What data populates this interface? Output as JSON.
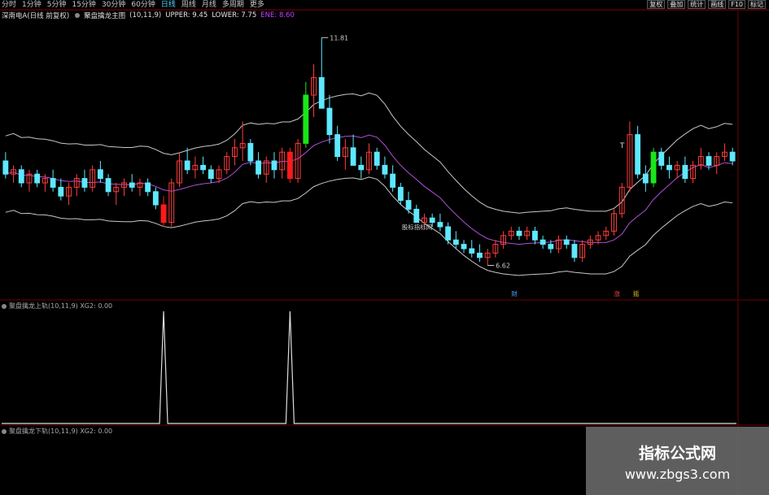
{
  "toolbar": {
    "periods": [
      "分时",
      "1分钟",
      "5分钟",
      "15分钟",
      "30分钟",
      "60分钟",
      "日线",
      "周线",
      "月线",
      "多周期",
      "更多"
    ],
    "active_period": "日线",
    "tools": [
      "复权",
      "叠加",
      "统计",
      "画线",
      "F10",
      "标记"
    ]
  },
  "main_panel": {
    "stock_name": "深南电A(日线 前复权)",
    "indicator_name": "聚盘擒龙主图",
    "params": "(10,11,9)",
    "upper_label": "UPPER: 9.45",
    "lower_label": "LOWER: 7.75",
    "ene_label": "ENE: 8.60",
    "high_annotation": "11.81",
    "low_annotation": "6.62",
    "overlay_text": "股标指标网",
    "t_marker": "T",
    "bottom_markers": [
      "财",
      "涨",
      "摇"
    ],
    "colors": {
      "up": "#ff3c3c",
      "down": "#5ee8ff",
      "signal_red": "#ff1a1a",
      "signal_green": "#19e619",
      "band": "#c8c8c8",
      "ene": "#b14fd6",
      "grid": "#6b0000"
    }
  },
  "sub_panel_1": {
    "label": "聚盘擒龙上轨(10,11,9) XG2: 0.00"
  },
  "sub_panel_2": {
    "label": "聚盘擒龙下轨(10,11,9) XG2: 0.00"
  },
  "watermark": {
    "title": "指标公式网",
    "url": "www.zbgs3.com"
  },
  "chart_data": {
    "type": "candlestick",
    "price_high": 11.81,
    "price_low": 6.62,
    "candles": [
      [
        9.0,
        9.2,
        8.6,
        8.7
      ],
      [
        8.7,
        8.9,
        8.5,
        8.8
      ],
      [
        8.8,
        8.9,
        8.4,
        8.5
      ],
      [
        8.5,
        8.8,
        8.3,
        8.7
      ],
      [
        8.7,
        8.8,
        8.4,
        8.5
      ],
      [
        8.5,
        8.7,
        8.3,
        8.6
      ],
      [
        8.6,
        8.8,
        8.3,
        8.4
      ],
      [
        8.4,
        8.6,
        8.1,
        8.2
      ],
      [
        8.2,
        8.5,
        8.0,
        8.4
      ],
      [
        8.4,
        8.7,
        8.2,
        8.6
      ],
      [
        8.6,
        8.8,
        8.3,
        8.4
      ],
      [
        8.4,
        8.9,
        8.3,
        8.8
      ],
      [
        8.8,
        9.0,
        8.5,
        8.6
      ],
      [
        8.6,
        8.7,
        8.2,
        8.3
      ],
      [
        8.3,
        8.5,
        8.0,
        8.4
      ],
      [
        8.4,
        8.6,
        8.2,
        8.5
      ],
      [
        8.5,
        8.7,
        8.3,
        8.4
      ],
      [
        8.4,
        8.6,
        8.2,
        8.5
      ],
      [
        8.5,
        8.6,
        8.2,
        8.3
      ],
      [
        8.3,
        8.4,
        7.9,
        8.0
      ],
      [
        8.0,
        8.2,
        7.5,
        7.6
      ],
      [
        7.6,
        8.6,
        7.5,
        8.5
      ],
      [
        8.5,
        9.2,
        8.4,
        9.0
      ],
      [
        9.0,
        9.3,
        8.7,
        8.8
      ],
      [
        8.8,
        9.1,
        8.6,
        8.9
      ],
      [
        8.9,
        9.1,
        8.7,
        8.8
      ],
      [
        8.8,
        8.9,
        8.5,
        8.6
      ],
      [
        8.6,
        8.9,
        8.5,
        8.8
      ],
      [
        8.8,
        9.2,
        8.7,
        9.1
      ],
      [
        9.1,
        9.5,
        8.9,
        9.3
      ],
      [
        9.3,
        9.9,
        9.0,
        9.4
      ],
      [
        9.4,
        9.5,
        8.9,
        9.0
      ],
      [
        9.0,
        9.2,
        8.6,
        8.7
      ],
      [
        8.7,
        9.1,
        8.5,
        9.0
      ],
      [
        9.0,
        9.2,
        8.6,
        8.8
      ],
      [
        8.8,
        9.3,
        8.6,
        9.2
      ],
      [
        9.2,
        9.3,
        8.5,
        8.6
      ],
      [
        8.6,
        9.5,
        8.5,
        9.4
      ],
      [
        9.4,
        10.8,
        9.3,
        10.5
      ],
      [
        10.5,
        11.2,
        10.0,
        10.9
      ],
      [
        10.9,
        11.81,
        10.6,
        10.2
      ],
      [
        10.2,
        10.5,
        9.4,
        9.6
      ],
      [
        9.6,
        9.8,
        9.0,
        9.1
      ],
      [
        9.1,
        9.5,
        8.8,
        9.3
      ],
      [
        9.3,
        9.6,
        8.9,
        8.9
      ],
      [
        8.9,
        9.1,
        8.6,
        8.8
      ],
      [
        8.8,
        9.4,
        8.7,
        9.2
      ],
      [
        9.2,
        9.3,
        8.8,
        8.9
      ],
      [
        8.9,
        9.1,
        8.6,
        8.7
      ],
      [
        8.7,
        8.9,
        8.3,
        8.4
      ],
      [
        8.4,
        8.5,
        8.0,
        8.1
      ],
      [
        8.1,
        8.3,
        7.8,
        7.9
      ],
      [
        7.9,
        8.0,
        7.6,
        7.6
      ],
      [
        7.6,
        7.8,
        7.5,
        7.7
      ],
      [
        7.7,
        7.8,
        7.5,
        7.6
      ],
      [
        7.6,
        7.8,
        7.4,
        7.5
      ],
      [
        7.5,
        7.6,
        7.1,
        7.2
      ],
      [
        7.2,
        7.4,
        7.0,
        7.1
      ],
      [
        7.1,
        7.2,
        6.9,
        7.0
      ],
      [
        7.0,
        7.2,
        6.8,
        6.9
      ],
      [
        6.9,
        7.1,
        6.7,
        6.8
      ],
      [
        6.8,
        7.0,
        6.62,
        6.9
      ],
      [
        6.9,
        7.2,
        6.8,
        7.1
      ],
      [
        7.1,
        7.4,
        7.0,
        7.3
      ],
      [
        7.3,
        7.5,
        7.2,
        7.4
      ],
      [
        7.4,
        7.5,
        7.2,
        7.3
      ],
      [
        7.3,
        7.5,
        7.2,
        7.4
      ],
      [
        7.4,
        7.5,
        7.1,
        7.2
      ],
      [
        7.2,
        7.3,
        7.0,
        7.1
      ],
      [
        7.1,
        7.2,
        6.9,
        7.0
      ],
      [
        7.0,
        7.3,
        6.9,
        7.2
      ],
      [
        7.2,
        7.3,
        7.0,
        7.1
      ],
      [
        7.1,
        7.2,
        6.7,
        6.8
      ],
      [
        6.8,
        7.2,
        6.7,
        7.1
      ],
      [
        7.1,
        7.3,
        7.0,
        7.2
      ],
      [
        7.2,
        7.4,
        7.1,
        7.3
      ],
      [
        7.3,
        7.5,
        7.2,
        7.4
      ],
      [
        7.4,
        7.9,
        7.3,
        7.8
      ],
      [
        7.8,
        8.5,
        7.7,
        8.4
      ],
      [
        8.4,
        9.9,
        8.3,
        9.6
      ],
      [
        9.6,
        9.8,
        8.6,
        8.7
      ],
      [
        8.7,
        8.9,
        8.3,
        8.5
      ],
      [
        8.5,
        9.3,
        8.4,
        9.2
      ],
      [
        9.2,
        9.3,
        8.8,
        8.9
      ],
      [
        8.9,
        9.1,
        8.6,
        8.8
      ],
      [
        8.8,
        9.0,
        8.6,
        8.9
      ],
      [
        8.9,
        9.1,
        8.5,
        8.6
      ],
      [
        8.6,
        9.0,
        8.5,
        8.9
      ],
      [
        8.9,
        9.3,
        8.8,
        9.1
      ],
      [
        9.1,
        9.2,
        8.8,
        8.9
      ],
      [
        8.9,
        9.2,
        8.7,
        9.1
      ],
      [
        9.1,
        9.4,
        9.0,
        9.2
      ],
      [
        9.2,
        9.3,
        8.9,
        9.0
      ]
    ],
    "signals": {
      "red_bars": [
        20,
        36
      ],
      "green_bars": [
        38,
        82
      ]
    },
    "spikes": [
      20,
      36
    ]
  }
}
